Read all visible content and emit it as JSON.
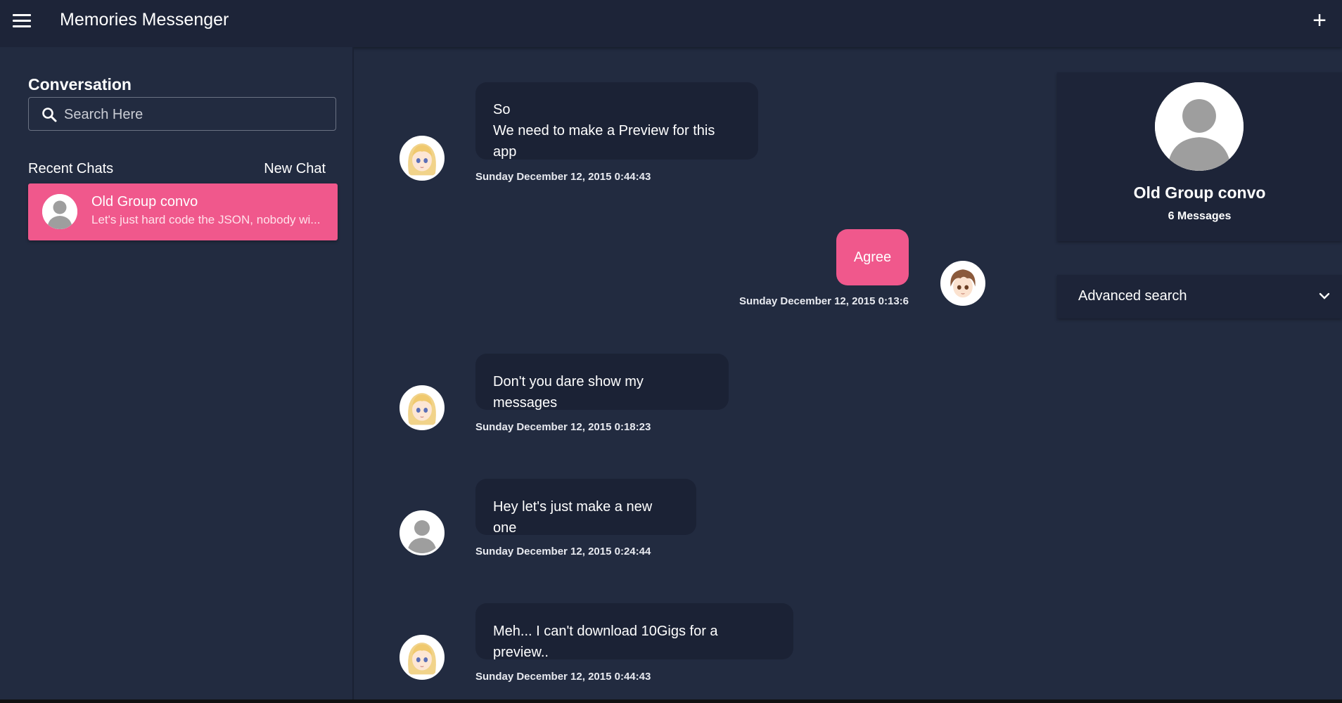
{
  "app": {
    "title": "Memories Messenger"
  },
  "colors": {
    "accent": "#f0588c",
    "background": "#222b40",
    "bar": "#1d2438",
    "bubble": "#1b2235"
  },
  "icons": {
    "menu": "menu-icon",
    "add": "plus-icon",
    "search": "search-icon",
    "expand": "chevron-down-icon"
  },
  "sidebar": {
    "heading": "Conversation",
    "search_placeholder": "Search Here",
    "recent_label": "Recent Chats",
    "new_chat_label": "New Chat",
    "chats": [
      {
        "name": "Old Group convo",
        "preview": "Let's just hard code the JSON, nobody wi..."
      }
    ]
  },
  "messages": [
    {
      "lines": [
        "So",
        "We need to make a Preview for this app"
      ],
      "time": "Sunday December 12, 2015 0:44:43",
      "mine": false,
      "avatar": "blonde-girl"
    },
    {
      "lines": [
        "Agree"
      ],
      "time": "Sunday December 12, 2015 0:13:6",
      "mine": true,
      "avatar": "brown-hair-boy"
    },
    {
      "lines": [
        "Don't you dare show my messages"
      ],
      "time": "Sunday December 12, 2015 0:18:23",
      "mine": false,
      "avatar": "blonde-girl"
    },
    {
      "lines": [
        "Hey let's just make a new one"
      ],
      "time": "Sunday December 12, 2015 0:24:44",
      "mine": false,
      "avatar": "default-user"
    },
    {
      "lines": [
        "Meh... I can't download 10Gigs for a preview.."
      ],
      "time": "Sunday December 12, 2015 0:44:43",
      "mine": false,
      "avatar": "blonde-girl"
    }
  ],
  "profile": {
    "name": "Old Group convo",
    "message_count": "6 Messages"
  },
  "advanced_search": {
    "label": "Advanced search"
  }
}
